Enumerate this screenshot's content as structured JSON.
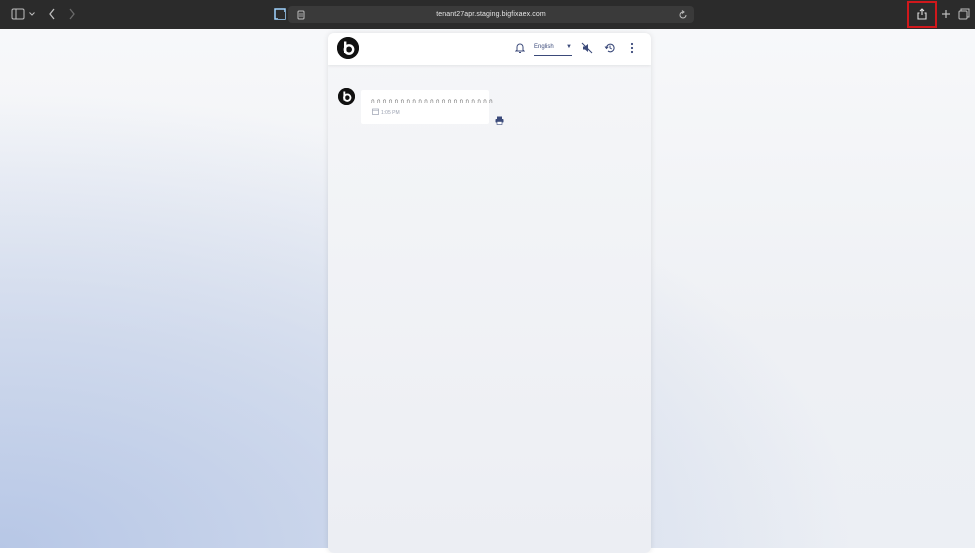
{
  "browser": {
    "url": "tenant27apr.staging.bigfixaex.com",
    "icons": {
      "sidebar": "sidebar-icon",
      "back": "chevron-left-icon",
      "forward": "chevron-right-icon",
      "reader": "reader-icon",
      "site": "site-shield-icon",
      "reload": "reload-icon",
      "share": "share-icon",
      "new_tab": "plus-icon",
      "tabs": "tabs-overview-icon"
    }
  },
  "chat": {
    "language": "English",
    "message": {
      "text": "ก ก ก ก ก ก ก ก ก ก ก ก ก ก ก ก ก ก ก ก ก",
      "time": "1:05 PM"
    }
  },
  "colors": {
    "toolbar_bg": "#2b2b2b",
    "accent": "#3b4a7a",
    "highlight": "#d0181c"
  }
}
